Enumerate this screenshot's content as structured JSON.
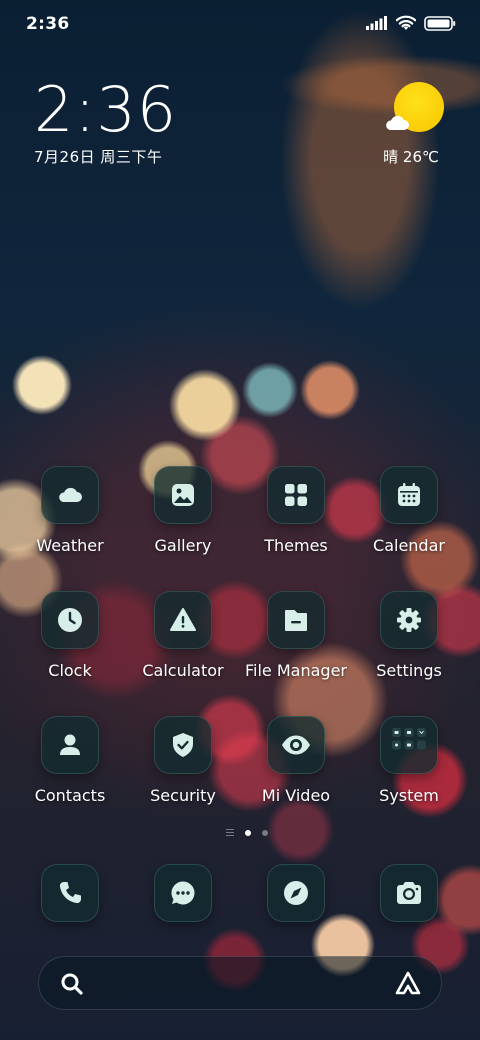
{
  "status_bar": {
    "time": "2:36",
    "icons": [
      "signal-icon",
      "wifi-icon",
      "battery-icon"
    ]
  },
  "clock_widget": {
    "time": "2:36",
    "date": "7月26日 周三下午"
  },
  "weather_widget": {
    "condition_icon": "sun-cloud-icon",
    "text": "晴 26℃"
  },
  "apps": [
    {
      "label": "Weather",
      "icon": "weather-cloud-icon"
    },
    {
      "label": "Gallery",
      "icon": "gallery-image-icon"
    },
    {
      "label": "Themes",
      "icon": "themes-grid-icon"
    },
    {
      "label": "Calendar",
      "icon": "calendar-icon"
    },
    {
      "label": "Clock",
      "icon": "clock-icon"
    },
    {
      "label": "Calculator",
      "icon": "warning-triangle-icon"
    },
    {
      "label": "File Manager",
      "icon": "folder-icon"
    },
    {
      "label": "Settings",
      "icon": "gear-icon"
    },
    {
      "label": "Contacts",
      "icon": "person-icon"
    },
    {
      "label": "Security",
      "icon": "shield-check-icon"
    },
    {
      "label": "Mi Video",
      "icon": "eye-icon"
    },
    {
      "label": "System",
      "icon": "folder-grid-icon"
    }
  ],
  "page_indicator": {
    "pages": 2,
    "current": 1
  },
  "dock": [
    {
      "icon": "phone-icon"
    },
    {
      "icon": "message-icon"
    },
    {
      "icon": "compass-icon"
    },
    {
      "icon": "camera-icon"
    }
  ],
  "search_bar": {
    "left_icon": "search-icon",
    "right_icon": "assistant-icon"
  },
  "colors": {
    "icon_glyph": "#d8efe9",
    "icon_bg": "#122c30",
    "sun": "#f7c500"
  }
}
